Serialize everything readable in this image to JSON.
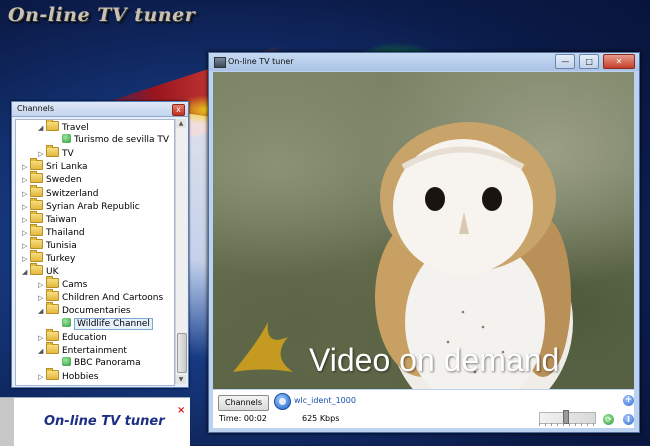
{
  "desktop": {
    "title": "On-line TV tuner"
  },
  "channels_window": {
    "title": "Channels",
    "close": "x",
    "tree": [
      {
        "label": "Travel",
        "icon": "folder-icon",
        "expand": "◢"
      },
      {
        "label": "Turismo de sevilla TV",
        "icon": "tv-channel-icon",
        "expand": ""
      },
      {
        "label": "TV",
        "icon": "folder-icon",
        "expand": "▷"
      },
      {
        "label": "Sri Lanka",
        "icon": "folder-icon",
        "expand": "▷"
      },
      {
        "label": "Sweden",
        "icon": "folder-icon",
        "expand": "▷"
      },
      {
        "label": "Switzerland",
        "icon": "folder-icon",
        "expand": "▷"
      },
      {
        "label": "Syrian Arab Republic",
        "icon": "folder-icon",
        "expand": "▷"
      },
      {
        "label": "Taiwan",
        "icon": "folder-icon",
        "expand": "▷"
      },
      {
        "label": "Thailand",
        "icon": "folder-icon",
        "expand": "▷"
      },
      {
        "label": "Tunisia",
        "icon": "folder-icon",
        "expand": "▷"
      },
      {
        "label": "Turkey",
        "icon": "folder-icon",
        "expand": "▷"
      },
      {
        "label": "UK",
        "icon": "folder-icon",
        "expand": "◢"
      },
      {
        "label": "Cams",
        "icon": "folder-icon",
        "expand": "▷"
      },
      {
        "label": "Children And Cartoons",
        "icon": "folder-icon",
        "expand": "▷"
      },
      {
        "label": "Documentaries",
        "icon": "folder-icon",
        "expand": "◢"
      },
      {
        "label": "Wildlife Channel",
        "icon": "tv-channel-icon",
        "expand": ""
      },
      {
        "label": "Education",
        "icon": "folder-icon",
        "expand": "▷"
      },
      {
        "label": "Entertainment",
        "icon": "folder-icon",
        "expand": "◢"
      },
      {
        "label": "BBC Panorama",
        "icon": "tv-channel-icon",
        "expand": ""
      },
      {
        "label": "Hobbies",
        "icon": "folder-icon",
        "expand": "▷"
      }
    ],
    "selected": "Wildlife Channel"
  },
  "notification": {
    "text": "On-line TV tuner",
    "close": "×"
  },
  "tv_window": {
    "title": "On-line TV tuner",
    "controls": {
      "minimize": "—",
      "maximize": "□",
      "close": "✕"
    },
    "overlay_text": "Video on demand",
    "channels_button": "Channels",
    "stream_name": "wlc_ident_1000",
    "time": "Time: 00:02",
    "bitrate": "625 Kbps",
    "volume_level": 0.47,
    "add": "+",
    "refresh": "⟳",
    "info": "i"
  },
  "colors": {
    "accent": "#2e6bd1",
    "channel_icon": "#2e9b3f",
    "folder": "#e2b93b",
    "notify_text": "#1d2f85"
  }
}
